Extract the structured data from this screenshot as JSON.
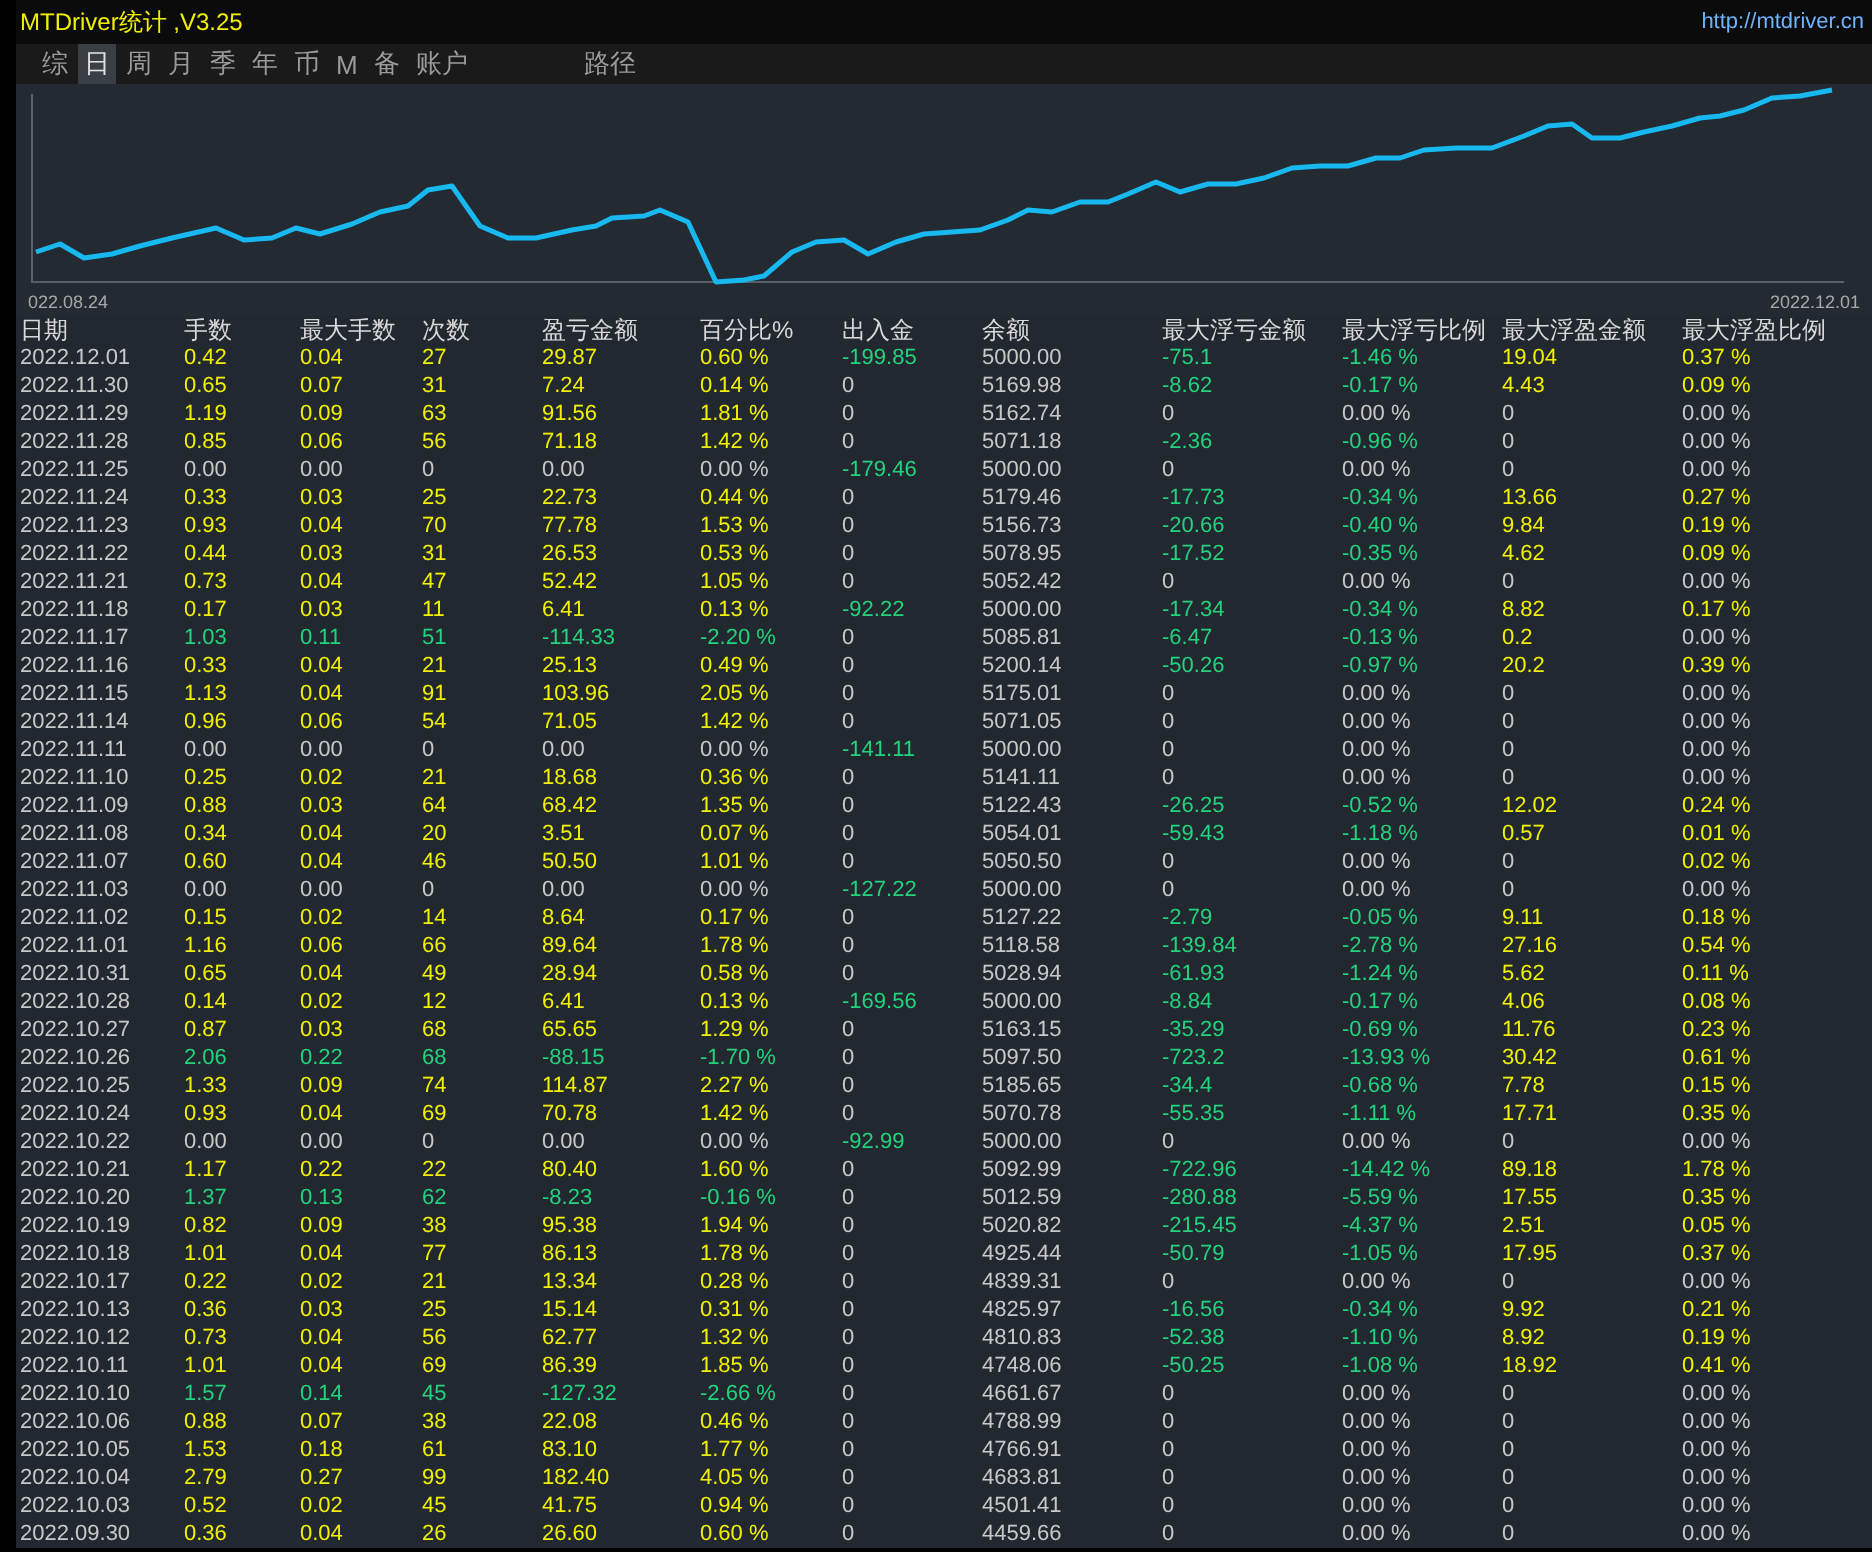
{
  "window": {
    "title": "MTDriver统计 ,V3.25",
    "link": "http://mtdriver.cn"
  },
  "tabs": [
    {
      "label": "综",
      "selected": false
    },
    {
      "label": "日",
      "selected": true
    },
    {
      "label": "周",
      "selected": false
    },
    {
      "label": "月",
      "selected": false
    },
    {
      "label": "季",
      "selected": false
    },
    {
      "label": "年",
      "selected": false
    },
    {
      "label": "币",
      "selected": false
    },
    {
      "label": "M",
      "selected": false
    },
    {
      "label": "备",
      "selected": false
    },
    {
      "label": "账户",
      "selected": false
    },
    {
      "label": "路径",
      "selected": false
    }
  ],
  "chart": {
    "start_label": "022.08.24",
    "end_label": "2022.12.01"
  },
  "table": {
    "columns": [
      "日期",
      "手数",
      "最大手数",
      "次数",
      "盈亏金额",
      "百分比%",
      "出入金",
      "余额",
      "最大浮亏金额",
      "最大浮亏比例",
      "最大浮盈金额",
      "最大浮盈比例"
    ],
    "rows": [
      {
        "cells": [
          "2022.12.01",
          "0.42",
          "0.04",
          "27",
          "29.87",
          "0.60 %",
          "-199.85",
          "5000.00",
          "-75.1",
          "-1.46 %",
          "19.04",
          "0.37 %"
        ],
        "kind": "gain",
        "cash_flow": true,
        "float_loss": true,
        "float_gain": true,
        "float_gain_pct": true
      },
      {
        "cells": [
          "2022.11.30",
          "0.65",
          "0.07",
          "31",
          "7.24",
          "0.14 %",
          "0",
          "5169.98",
          "-8.62",
          "-0.17 %",
          "4.43",
          "0.09 %"
        ],
        "kind": "gain",
        "cash_flow": false,
        "float_loss": true,
        "float_gain": true,
        "float_gain_pct": true
      },
      {
        "cells": [
          "2022.11.29",
          "1.19",
          "0.09",
          "63",
          "91.56",
          "1.81 %",
          "0",
          "5162.74",
          "0",
          "0.00 %",
          "0",
          "0.00 %"
        ],
        "kind": "gain",
        "cash_flow": false,
        "float_loss": false,
        "float_gain": false,
        "float_gain_pct": false
      },
      {
        "cells": [
          "2022.11.28",
          "0.85",
          "0.06",
          "56",
          "71.18",
          "1.42 %",
          "0",
          "5071.18",
          "-2.36",
          "-0.96 %",
          "0",
          "0.00 %"
        ],
        "kind": "gain",
        "cash_flow": false,
        "float_loss": true,
        "float_gain": false,
        "float_gain_pct": false
      },
      {
        "cells": [
          "2022.11.25",
          "0.00",
          "0.00",
          "0",
          "0.00",
          "0.00 %",
          "-179.46",
          "5000.00",
          "0",
          "0.00 %",
          "0",
          "0.00 %"
        ],
        "kind": "flat",
        "cash_flow": true,
        "float_loss": false,
        "float_gain": false,
        "float_gain_pct": false
      },
      {
        "cells": [
          "2022.11.24",
          "0.33",
          "0.03",
          "25",
          "22.73",
          "0.44 %",
          "0",
          "5179.46",
          "-17.73",
          "-0.34 %",
          "13.66",
          "0.27 %"
        ],
        "kind": "gain",
        "cash_flow": false,
        "float_loss": true,
        "float_gain": true,
        "float_gain_pct": true
      },
      {
        "cells": [
          "2022.11.23",
          "0.93",
          "0.04",
          "70",
          "77.78",
          "1.53 %",
          "0",
          "5156.73",
          "-20.66",
          "-0.40 %",
          "9.84",
          "0.19 %"
        ],
        "kind": "gain",
        "cash_flow": false,
        "float_loss": true,
        "float_gain": true,
        "float_gain_pct": true
      },
      {
        "cells": [
          "2022.11.22",
          "0.44",
          "0.03",
          "31",
          "26.53",
          "0.53 %",
          "0",
          "5078.95",
          "-17.52",
          "-0.35 %",
          "4.62",
          "0.09 %"
        ],
        "kind": "gain",
        "cash_flow": false,
        "float_loss": true,
        "float_gain": true,
        "float_gain_pct": true
      },
      {
        "cells": [
          "2022.11.21",
          "0.73",
          "0.04",
          "47",
          "52.42",
          "1.05 %",
          "0",
          "5052.42",
          "0",
          "0.00 %",
          "0",
          "0.00 %"
        ],
        "kind": "gain",
        "cash_flow": false,
        "float_loss": false,
        "float_gain": false,
        "float_gain_pct": false
      },
      {
        "cells": [
          "2022.11.18",
          "0.17",
          "0.03",
          "11",
          "6.41",
          "0.13 %",
          "-92.22",
          "5000.00",
          "-17.34",
          "-0.34 %",
          "8.82",
          "0.17 %"
        ],
        "kind": "gain",
        "cash_flow": true,
        "float_loss": true,
        "float_gain": true,
        "float_gain_pct": true
      },
      {
        "cells": [
          "2022.11.17",
          "1.03",
          "0.11",
          "51",
          "-114.33",
          "-2.20 %",
          "0",
          "5085.81",
          "-6.47",
          "-0.13 %",
          "0.2",
          "0.00 %"
        ],
        "kind": "loss",
        "cash_flow": false,
        "float_loss": true,
        "float_gain": true,
        "float_gain_pct": false
      },
      {
        "cells": [
          "2022.11.16",
          "0.33",
          "0.04",
          "21",
          "25.13",
          "0.49 %",
          "0",
          "5200.14",
          "-50.26",
          "-0.97 %",
          "20.2",
          "0.39 %"
        ],
        "kind": "gain",
        "cash_flow": false,
        "float_loss": true,
        "float_gain": true,
        "float_gain_pct": true
      },
      {
        "cells": [
          "2022.11.15",
          "1.13",
          "0.04",
          "91",
          "103.96",
          "2.05 %",
          "0",
          "5175.01",
          "0",
          "0.00 %",
          "0",
          "0.00 %"
        ],
        "kind": "gain",
        "cash_flow": false,
        "float_loss": false,
        "float_gain": false,
        "float_gain_pct": false
      },
      {
        "cells": [
          "2022.11.14",
          "0.96",
          "0.06",
          "54",
          "71.05",
          "1.42 %",
          "0",
          "5071.05",
          "0",
          "0.00 %",
          "0",
          "0.00 %"
        ],
        "kind": "gain",
        "cash_flow": false,
        "float_loss": false,
        "float_gain": false,
        "float_gain_pct": false
      },
      {
        "cells": [
          "2022.11.11",
          "0.00",
          "0.00",
          "0",
          "0.00",
          "0.00 %",
          "-141.11",
          "5000.00",
          "0",
          "0.00 %",
          "0",
          "0.00 %"
        ],
        "kind": "flat",
        "cash_flow": true,
        "float_loss": false,
        "float_gain": false,
        "float_gain_pct": false
      },
      {
        "cells": [
          "2022.11.10",
          "0.25",
          "0.02",
          "21",
          "18.68",
          "0.36 %",
          "0",
          "5141.11",
          "0",
          "0.00 %",
          "0",
          "0.00 %"
        ],
        "kind": "gain",
        "cash_flow": false,
        "float_loss": false,
        "float_gain": false,
        "float_gain_pct": false
      },
      {
        "cells": [
          "2022.11.09",
          "0.88",
          "0.03",
          "64",
          "68.42",
          "1.35 %",
          "0",
          "5122.43",
          "-26.25",
          "-0.52 %",
          "12.02",
          "0.24 %"
        ],
        "kind": "gain",
        "cash_flow": false,
        "float_loss": true,
        "float_gain": true,
        "float_gain_pct": true
      },
      {
        "cells": [
          "2022.11.08",
          "0.34",
          "0.04",
          "20",
          "3.51",
          "0.07 %",
          "0",
          "5054.01",
          "-59.43",
          "-1.18 %",
          "0.57",
          "0.01 %"
        ],
        "kind": "gain",
        "cash_flow": false,
        "float_loss": true,
        "float_gain": true,
        "float_gain_pct": true
      },
      {
        "cells": [
          "2022.11.07",
          "0.60",
          "0.04",
          "46",
          "50.50",
          "1.01 %",
          "0",
          "5050.50",
          "0",
          "0.00 %",
          "0",
          "0.02 %"
        ],
        "kind": "gain",
        "cash_flow": false,
        "float_loss": false,
        "float_gain": false,
        "float_gain_pct": true
      },
      {
        "cells": [
          "2022.11.03",
          "0.00",
          "0.00",
          "0",
          "0.00",
          "0.00 %",
          "-127.22",
          "5000.00",
          "0",
          "0.00 %",
          "0",
          "0.00 %"
        ],
        "kind": "flat",
        "cash_flow": true,
        "float_loss": false,
        "float_gain": false,
        "float_gain_pct": false
      },
      {
        "cells": [
          "2022.11.02",
          "0.15",
          "0.02",
          "14",
          "8.64",
          "0.17 %",
          "0",
          "5127.22",
          "-2.79",
          "-0.05 %",
          "9.11",
          "0.18 %"
        ],
        "kind": "gain",
        "cash_flow": false,
        "float_loss": true,
        "float_gain": true,
        "float_gain_pct": true
      },
      {
        "cells": [
          "2022.11.01",
          "1.16",
          "0.06",
          "66",
          "89.64",
          "1.78 %",
          "0",
          "5118.58",
          "-139.84",
          "-2.78 %",
          "27.16",
          "0.54 %"
        ],
        "kind": "gain",
        "cash_flow": false,
        "float_loss": true,
        "float_gain": true,
        "float_gain_pct": true
      },
      {
        "cells": [
          "2022.10.31",
          "0.65",
          "0.04",
          "49",
          "28.94",
          "0.58 %",
          "0",
          "5028.94",
          "-61.93",
          "-1.24 %",
          "5.62",
          "0.11 %"
        ],
        "kind": "gain",
        "cash_flow": false,
        "float_loss": true,
        "float_gain": true,
        "float_gain_pct": true
      },
      {
        "cells": [
          "2022.10.28",
          "0.14",
          "0.02",
          "12",
          "6.41",
          "0.13 %",
          "-169.56",
          "5000.00",
          "-8.84",
          "-0.17 %",
          "4.06",
          "0.08 %"
        ],
        "kind": "gain",
        "cash_flow": true,
        "float_loss": true,
        "float_gain": true,
        "float_gain_pct": true
      },
      {
        "cells": [
          "2022.10.27",
          "0.87",
          "0.03",
          "68",
          "65.65",
          "1.29 %",
          "0",
          "5163.15",
          "-35.29",
          "-0.69 %",
          "11.76",
          "0.23 %"
        ],
        "kind": "gain",
        "cash_flow": false,
        "float_loss": true,
        "float_gain": true,
        "float_gain_pct": true
      },
      {
        "cells": [
          "2022.10.26",
          "2.06",
          "0.22",
          "68",
          "-88.15",
          "-1.70 %",
          "0",
          "5097.50",
          "-723.2",
          "-13.93 %",
          "30.42",
          "0.61 %"
        ],
        "kind": "loss",
        "cash_flow": false,
        "float_loss": true,
        "float_gain": true,
        "float_gain_pct": true
      },
      {
        "cells": [
          "2022.10.25",
          "1.33",
          "0.09",
          "74",
          "114.87",
          "2.27 %",
          "0",
          "5185.65",
          "-34.4",
          "-0.68 %",
          "7.78",
          "0.15 %"
        ],
        "kind": "gain",
        "cash_flow": false,
        "float_loss": true,
        "float_gain": true,
        "float_gain_pct": true
      },
      {
        "cells": [
          "2022.10.24",
          "0.93",
          "0.04",
          "69",
          "70.78",
          "1.42 %",
          "0",
          "5070.78",
          "-55.35",
          "-1.11 %",
          "17.71",
          "0.35 %"
        ],
        "kind": "gain",
        "cash_flow": false,
        "float_loss": true,
        "float_gain": true,
        "float_gain_pct": true
      },
      {
        "cells": [
          "2022.10.22",
          "0.00",
          "0.00",
          "0",
          "0.00",
          "0.00 %",
          "-92.99",
          "5000.00",
          "0",
          "0.00 %",
          "0",
          "0.00 %"
        ],
        "kind": "flat",
        "cash_flow": true,
        "float_loss": false,
        "float_gain": false,
        "float_gain_pct": false
      },
      {
        "cells": [
          "2022.10.21",
          "1.17",
          "0.22",
          "22",
          "80.40",
          "1.60 %",
          "0",
          "5092.99",
          "-722.96",
          "-14.42 %",
          "89.18",
          "1.78 %"
        ],
        "kind": "gain",
        "cash_flow": false,
        "float_loss": true,
        "float_gain": true,
        "float_gain_pct": true
      },
      {
        "cells": [
          "2022.10.20",
          "1.37",
          "0.13",
          "62",
          "-8.23",
          "-0.16 %",
          "0",
          "5012.59",
          "-280.88",
          "-5.59 %",
          "17.55",
          "0.35 %"
        ],
        "kind": "loss",
        "cash_flow": false,
        "float_loss": true,
        "float_gain": true,
        "float_gain_pct": true
      },
      {
        "cells": [
          "2022.10.19",
          "0.82",
          "0.09",
          "38",
          "95.38",
          "1.94 %",
          "0",
          "5020.82",
          "-215.45",
          "-4.37 %",
          "2.51",
          "0.05 %"
        ],
        "kind": "gain",
        "cash_flow": false,
        "float_loss": true,
        "float_gain": true,
        "float_gain_pct": true
      },
      {
        "cells": [
          "2022.10.18",
          "1.01",
          "0.04",
          "77",
          "86.13",
          "1.78 %",
          "0",
          "4925.44",
          "-50.79",
          "-1.05 %",
          "17.95",
          "0.37 %"
        ],
        "kind": "gain",
        "cash_flow": false,
        "float_loss": true,
        "float_gain": true,
        "float_gain_pct": true
      },
      {
        "cells": [
          "2022.10.17",
          "0.22",
          "0.02",
          "21",
          "13.34",
          "0.28 %",
          "0",
          "4839.31",
          "0",
          "0.00 %",
          "0",
          "0.00 %"
        ],
        "kind": "gain",
        "cash_flow": false,
        "float_loss": false,
        "float_gain": false,
        "float_gain_pct": false
      },
      {
        "cells": [
          "2022.10.13",
          "0.36",
          "0.03",
          "25",
          "15.14",
          "0.31 %",
          "0",
          "4825.97",
          "-16.56",
          "-0.34 %",
          "9.92",
          "0.21 %"
        ],
        "kind": "gain",
        "cash_flow": false,
        "float_loss": true,
        "float_gain": true,
        "float_gain_pct": true
      },
      {
        "cells": [
          "2022.10.12",
          "0.73",
          "0.04",
          "56",
          "62.77",
          "1.32 %",
          "0",
          "4810.83",
          "-52.38",
          "-1.10 %",
          "8.92",
          "0.19 %"
        ],
        "kind": "gain",
        "cash_flow": false,
        "float_loss": true,
        "float_gain": true,
        "float_gain_pct": true
      },
      {
        "cells": [
          "2022.10.11",
          "1.01",
          "0.04",
          "69",
          "86.39",
          "1.85 %",
          "0",
          "4748.06",
          "-50.25",
          "-1.08 %",
          "18.92",
          "0.41 %"
        ],
        "kind": "gain",
        "cash_flow": false,
        "float_loss": true,
        "float_gain": true,
        "float_gain_pct": true
      },
      {
        "cells": [
          "2022.10.10",
          "1.57",
          "0.14",
          "45",
          "-127.32",
          "-2.66 %",
          "0",
          "4661.67",
          "0",
          "0.00 %",
          "0",
          "0.00 %"
        ],
        "kind": "loss",
        "cash_flow": false,
        "float_loss": false,
        "float_gain": false,
        "float_gain_pct": false
      },
      {
        "cells": [
          "2022.10.06",
          "0.88",
          "0.07",
          "38",
          "22.08",
          "0.46 %",
          "0",
          "4788.99",
          "0",
          "0.00 %",
          "0",
          "0.00 %"
        ],
        "kind": "gain",
        "cash_flow": false,
        "float_loss": false,
        "float_gain": false,
        "float_gain_pct": false
      },
      {
        "cells": [
          "2022.10.05",
          "1.53",
          "0.18",
          "61",
          "83.10",
          "1.77 %",
          "0",
          "4766.91",
          "0",
          "0.00 %",
          "0",
          "0.00 %"
        ],
        "kind": "gain",
        "cash_flow": false,
        "float_loss": false,
        "float_gain": false,
        "float_gain_pct": false
      },
      {
        "cells": [
          "2022.10.04",
          "2.79",
          "0.27",
          "99",
          "182.40",
          "4.05 %",
          "0",
          "4683.81",
          "0",
          "0.00 %",
          "0",
          "0.00 %"
        ],
        "kind": "gain",
        "cash_flow": false,
        "float_loss": false,
        "float_gain": false,
        "float_gain_pct": false
      },
      {
        "cells": [
          "2022.10.03",
          "0.52",
          "0.02",
          "45",
          "41.75",
          "0.94 %",
          "0",
          "4501.41",
          "0",
          "0.00 %",
          "0",
          "0.00 %"
        ],
        "kind": "gain",
        "cash_flow": false,
        "float_loss": false,
        "float_gain": false,
        "float_gain_pct": false
      },
      {
        "cells": [
          "2022.09.30",
          "0.36",
          "0.04",
          "26",
          "26.60",
          "0.60 %",
          "0",
          "4459.66",
          "0",
          "0.00 %",
          "0",
          "0.00 %"
        ],
        "kind": "gain",
        "cash_flow": false,
        "float_loss": false,
        "float_gain": false,
        "float_gain_pct": false
      }
    ]
  }
}
